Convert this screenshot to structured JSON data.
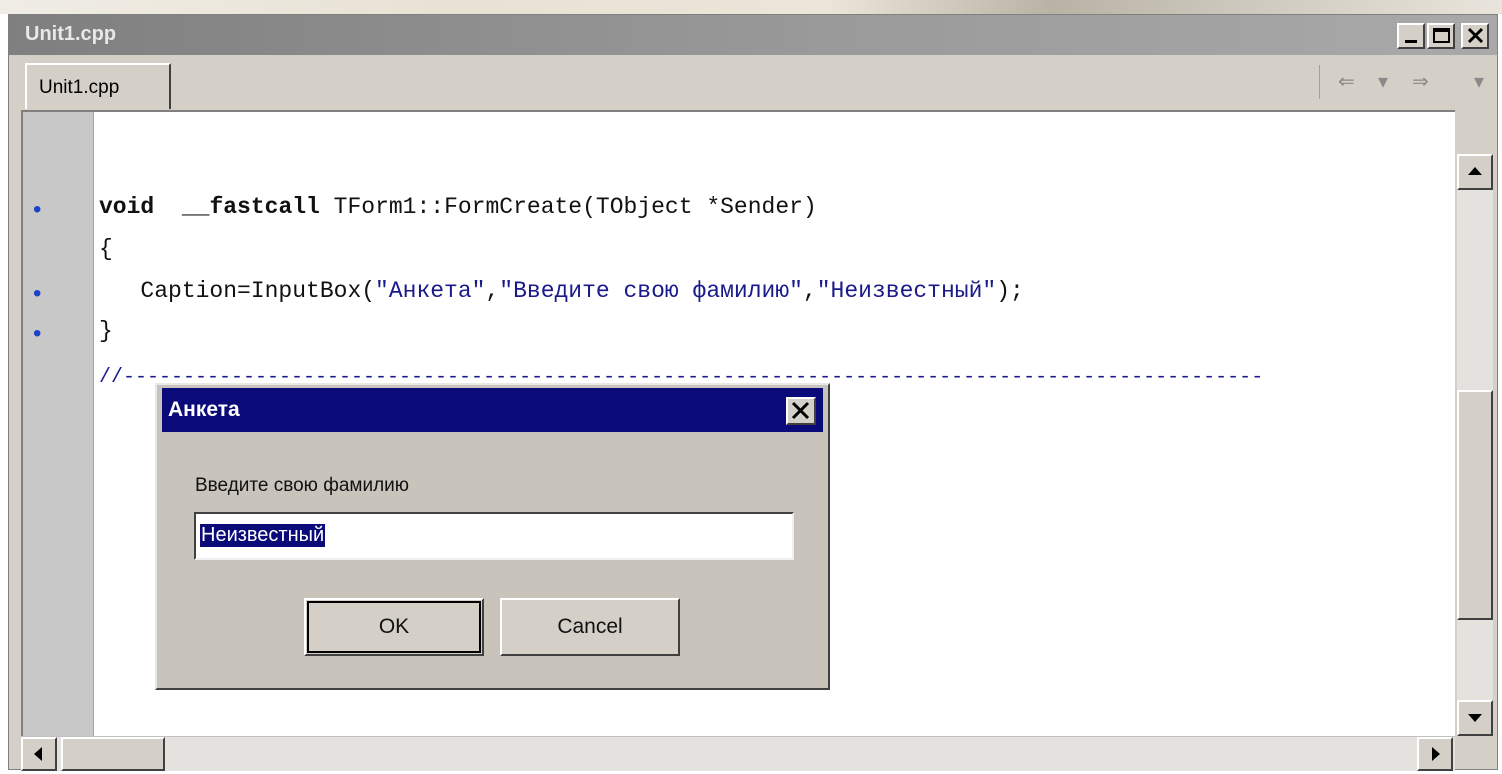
{
  "window": {
    "title": "Unit1.cpp",
    "tab_label": "Unit1.cpp",
    "nav_back": "⇐",
    "nav_back_dropdown": "▾",
    "nav_forward": "⇒",
    "nav_forward_dropdown": "▾"
  },
  "editor": {
    "gutter_marker": "•",
    "lines": [
      {
        "kw": "void",
        "mid": "  __",
        "kw2": "fastcall",
        "rest": " TForm1::FormCreate(TObject *Sender)"
      },
      {
        "text": "{"
      },
      {
        "pre": "   Caption=InputBox(",
        "s1": "\"Анкета\"",
        "c1": ",",
        "s2": "\"Введите свою фамилию\"",
        "c2": ",",
        "s3": "\"Неизвестный\"",
        "post": ");"
      },
      {
        "text": "}"
      },
      {
        "text": "//-----------------------------------------------------------------------------------------------"
      }
    ]
  },
  "dialog": {
    "title": "Анкета",
    "prompt": "Введите свою фамилию",
    "input_value": "Неизвестный",
    "ok_label": "OK",
    "cancel_label": "Cancel"
  },
  "colors": {
    "dialog_title_bg": "#0a0a78",
    "string_literal": "#1a1a8a",
    "gutter_marker": "#1a44c8"
  }
}
